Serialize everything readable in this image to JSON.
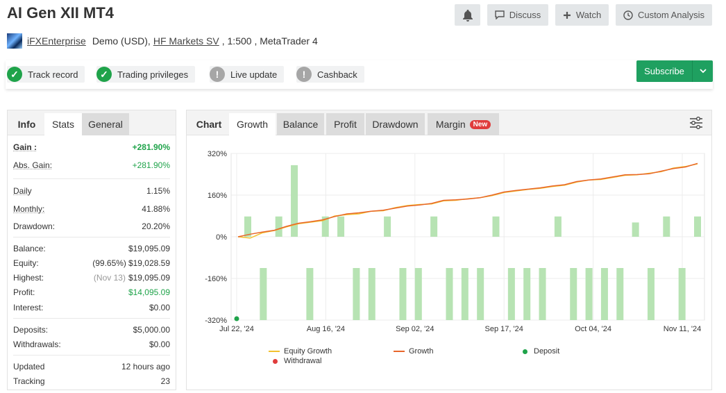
{
  "header": {
    "title": "AI Gen XII MT4",
    "discuss_label": "Discuss",
    "watch_label": "Watch",
    "custom_analysis_label": "Custom Analysis"
  },
  "account": {
    "owner": "iFXEnterprise",
    "type": "Demo (USD),",
    "broker": "HF Markets SV",
    "leverage": ", 1:500 , MetaTrader 4"
  },
  "badges": [
    {
      "label": "Track record",
      "status": "ok"
    },
    {
      "label": "Trading privileges",
      "status": "ok"
    },
    {
      "label": "Live update",
      "status": "warn"
    },
    {
      "label": "Cashback",
      "status": "warn"
    }
  ],
  "subscribe_label": "Subscribe",
  "stats_tabs": [
    "Info",
    "Stats",
    "General"
  ],
  "stats": {
    "gain": {
      "k": "Gain :",
      "v": "+281.90%"
    },
    "abs_gain": {
      "k": "Abs. Gain:",
      "v": "+281.90%"
    },
    "daily": {
      "k": "Daily",
      "v": "1.15%"
    },
    "monthly": {
      "k": "Monthly:",
      "v": "41.88%"
    },
    "drawdown": {
      "k": "Drawdown:",
      "v": "20.20%"
    },
    "balance": {
      "k": "Balance:",
      "v": "$19,095.09"
    },
    "equity": {
      "k": "Equity:",
      "note": "(99.65%)",
      "v": "$19,028.59"
    },
    "highest": {
      "k": "Highest:",
      "note": "(Nov 13)",
      "v": "$19,095.09"
    },
    "profit": {
      "k": "Profit:",
      "v": "$14,095.09"
    },
    "interest": {
      "k": "Interest:",
      "v": "$0.00"
    },
    "deposits": {
      "k": "Deposits:",
      "v": "$5,000.00"
    },
    "withdrawals": {
      "k": "Withdrawals:",
      "v": "$0.00"
    },
    "updated": {
      "k": "Updated",
      "v": "12 hours ago"
    },
    "tracking": {
      "k": "Tracking",
      "v": "23"
    }
  },
  "chart_tabs": [
    "Chart",
    "Growth",
    "Balance",
    "Profit",
    "Drawdown",
    "Margin"
  ],
  "new_badge": "New",
  "colors": {
    "accent_green": "#1fa34a",
    "bar_green": "#b7e3b3",
    "growth": "#e8662a",
    "equity": "#f2c12e",
    "withdrawal": "#e03c3c",
    "deposit": "#1fa34a"
  },
  "chart_data": {
    "type": "bar+line",
    "x_ticks": [
      "Jul 22, '24",
      "Aug 16, '24",
      "Sep 02, '24",
      "Sep 17, '24",
      "Oct 04, '24",
      "Nov 11, '24"
    ],
    "y_ticks": [
      "320%",
      "160%",
      "0%",
      "-160%",
      "-320%"
    ],
    "ylim": [
      -320,
      320
    ],
    "bars": [
      78,
      -120,
      78,
      275,
      -120,
      78,
      78,
      -120,
      -120,
      78,
      -120,
      -120,
      78,
      -320,
      -120,
      -120,
      78,
      -120,
      -120,
      -120,
      78,
      -120,
      -120,
      -120,
      -120,
      55,
      -120,
      78,
      -120,
      78
    ],
    "growth": [
      0,
      10,
      18,
      25,
      40,
      52,
      58,
      65,
      78,
      88,
      92,
      98,
      102,
      110,
      118,
      122,
      128,
      140,
      142,
      145,
      150,
      160,
      172,
      178,
      183,
      188,
      195,
      200,
      212,
      218,
      222,
      230,
      238,
      239,
      242,
      252,
      262,
      268,
      282
    ],
    "equity": [
      0,
      -5,
      15,
      24,
      38,
      50,
      56,
      62,
      80,
      85,
      88,
      98,
      100,
      112,
      120,
      124,
      126,
      138,
      140,
      146,
      150,
      158,
      170,
      176,
      182,
      186,
      193,
      198,
      210,
      218,
      220,
      228,
      236,
      238,
      244,
      250,
      264,
      270,
      280
    ],
    "legend": [
      "Equity Growth",
      "Growth",
      "Deposit",
      "Withdrawal"
    ]
  }
}
